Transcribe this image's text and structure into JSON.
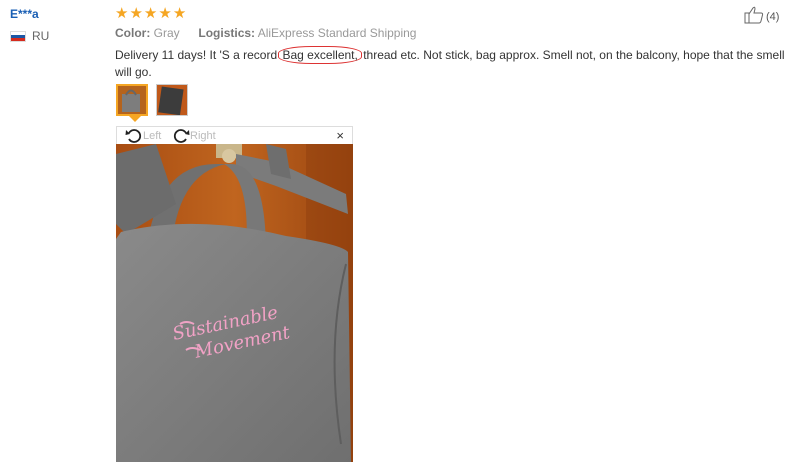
{
  "reviewer": {
    "name": "E***a",
    "country_code": "RU",
    "flag_colors": [
      "#ffffff",
      "#1c57a5",
      "#d52b1e"
    ]
  },
  "rating": {
    "stars": 5,
    "max": 5,
    "star_color": "#f5a623"
  },
  "meta": {
    "color_label": "Color:",
    "color_value": "Gray",
    "logistics_label": "Logistics:",
    "logistics_value": "AliExpress Standard Shipping"
  },
  "likes": {
    "count_text": "(4)"
  },
  "review": {
    "text_before": "Delivery 11 days! It 'S a record ",
    "text_highlighted": "Bag excellent,",
    "text_after": " thread etc. Not stick, bag approx. Smell not, on the balcony, hope that the smell will go."
  },
  "viewer": {
    "rotate_left_label": "Left",
    "rotate_right_label": "Right",
    "close_symbol": "×",
    "photo_print_line1": "Sustainable",
    "photo_print_line2": "Movement"
  },
  "colors": {
    "accent": "#f5a623",
    "name_blue": "#1a5fb4",
    "highlight_red": "#dd3333"
  }
}
